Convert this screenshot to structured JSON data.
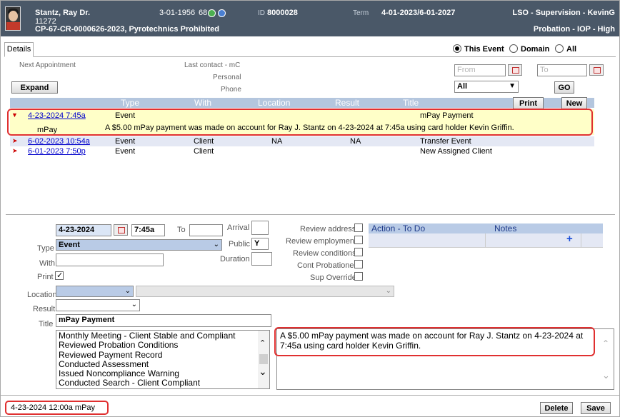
{
  "header": {
    "name": "Stantz, Ray Dr.",
    "number": "11272",
    "case": "CP-67-CR-0000626-2023, Pyrotechnics Prohibited",
    "dob": "3-01-1956",
    "age": "68",
    "id_label": "ID",
    "id_value": "8000028",
    "term_label": "Term",
    "term_value": "4-01-2023/6-01-2027",
    "officer": "LSO - Supervision - KevinG",
    "program": "Probation - IOP - High",
    "status_colors": [
      "#4caf50",
      "#4a7fd1"
    ]
  },
  "tabs": [
    "Details"
  ],
  "filter": {
    "options": [
      "This Event",
      "Domain",
      "All"
    ],
    "selected": "This Event",
    "from_placeholder": "From",
    "to_placeholder": "To",
    "type_select": "All",
    "go_label": "GO"
  },
  "info": {
    "next_appointment": "Next Appointment",
    "last_contact": "Last contact - mC",
    "personal": "Personal",
    "phone": "Phone",
    "expand_label": "Expand"
  },
  "grid": {
    "columns": [
      "Type",
      "With",
      "Location",
      "Result",
      "Title"
    ],
    "print_label": "Print",
    "new_label": "New",
    "rows": [
      {
        "date": "4-23-2024  7:45a",
        "type": "Event",
        "with": "",
        "location": "",
        "result": "",
        "title": "mPay Payment",
        "sub_left": "mPay",
        "sub_detail": "A $5.00 mPay payment was made on account for Ray J. Stantz on 4-23-2024 at 7:45a using card holder Kevin Griffin."
      },
      {
        "date": "6-02-2023 10:54a",
        "type": "Event",
        "with": "Client",
        "location": "NA",
        "result": "NA",
        "title": "Transfer Event"
      },
      {
        "date": "6-01-2023  7:50p",
        "type": "Event",
        "with": "Client",
        "location": "",
        "result": "",
        "title": "New Assigned Client"
      }
    ]
  },
  "form": {
    "date": "4-23-2024",
    "time": "7:45a",
    "to_label": "To",
    "arrival_label": "Arrival",
    "type_label": "Type",
    "type_value": "Event",
    "public_label": "Public",
    "public_value": "Y",
    "with_label": "With",
    "duration_label": "Duration",
    "print_label": "Print",
    "location_label": "Location",
    "result_label": "Result",
    "title_label": "Title",
    "title_value": "mPay Payment",
    "review_checks": [
      "Review address",
      "Review employment",
      "Review conditions",
      "Cont Probationer",
      "Sup Override"
    ],
    "action_header": "Action - To Do",
    "notes_header": "Notes",
    "add_symbol": "+",
    "templates": [
      "Monthly Meeting - Client Stable and Compliant",
      "Reviewed Probation Conditions",
      "Reviewed Payment Record",
      "Conducted Assessment",
      "Issued Noncompliance Warning",
      "Conducted Search - Client Compliant"
    ],
    "notes_text": "A $5.00 mPay payment was made on account for Ray J. Stantz on 4-23-2024 at 7:45a using card holder Kevin Griffin."
  },
  "footer": {
    "stamp": "4-23-2024   12:00a     mPay",
    "delete_label": "Delete",
    "save_label": "Save"
  },
  "colors": {
    "header_bg": "#4a5868",
    "grid_header": "#b4c6de",
    "highlight": "#e03030",
    "selected_row": "#ffffc8"
  }
}
